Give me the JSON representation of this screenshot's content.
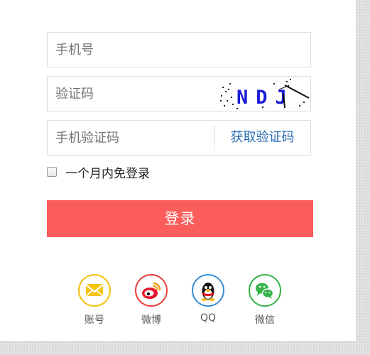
{
  "form": {
    "phone_placeholder": "手机号",
    "captcha_placeholder": "验证码",
    "captcha_text": "NDJ",
    "sms_placeholder": "手机验证码",
    "sms_button": "获取验证码",
    "remember_label": "一个月内免登录",
    "login_button": "登录"
  },
  "social": {
    "account": {
      "label": "账号",
      "icon": "mail-icon",
      "color": "#f5c00f"
    },
    "weibo": {
      "label": "微博",
      "icon": "weibo-icon",
      "color": "#e8403c"
    },
    "qq": {
      "label": "QQ",
      "icon": "qq-penguin-icon",
      "color": "#3a8fd6"
    },
    "wechat": {
      "label": "微信",
      "icon": "wechat-icon",
      "color": "#37b34a"
    }
  },
  "colors": {
    "accent": "#fa5d5a",
    "link": "#2c6fb4"
  }
}
